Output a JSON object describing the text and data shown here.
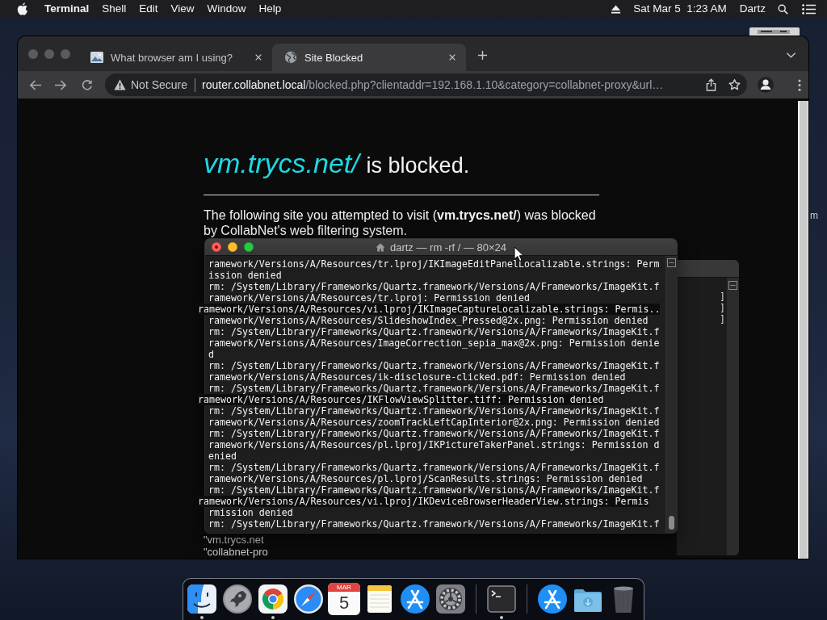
{
  "menu_bar": {
    "app": "Terminal",
    "menus": [
      "Shell",
      "Edit",
      "View",
      "Window",
      "Help"
    ],
    "clock": "Sat Mar 5  1:23 AM",
    "user": "Dartz"
  },
  "desktop": {
    "label": "m"
  },
  "browser": {
    "tabs": [
      {
        "title": "What browser am I using?",
        "selected": false
      },
      {
        "title": "Site Blocked",
        "selected": true
      }
    ],
    "address": {
      "security": "Not Secure",
      "host": "router.collabnet.local",
      "path": "/blocked.php?clientaddr=192.168.1.10&category=collabnet-proxy&url…"
    },
    "page": {
      "blocked_site": "vm.trycs.net/",
      "heading": "is blocked.",
      "message": "The following site you attempted to visit (**vm.trycs.net/**) was blocked by CollabNet's web filtering system.",
      "details": [
        "\"vm.trycs.net",
        "\"collabnet-pro"
      ]
    }
  },
  "background_window": {
    "lines": [
      "]",
      "]",
      "]"
    ]
  },
  "terminal": {
    "title": "dartz — rm -rf / — 80×24",
    "lines": [
      {
        "kind": "normal",
        "text": "ramework/Versions/A/Resources/tr.lproj/IKImageEditPanelLocalizable.strings: Perm"
      },
      {
        "kind": "normal",
        "text": "ission denied"
      },
      {
        "kind": "normal",
        "text": "rm: /System/Library/Frameworks/Quartz.framework/Versions/A/Frameworks/ImageKit.f"
      },
      {
        "kind": "normal",
        "text": "ramework/Versions/A/Resources/tr.lproj: Permission denied"
      },
      {
        "kind": "shifted",
        "text": "ramework/Versions/A/Resources/vi.lproj/IKImageCaptureLocalizable.strings: Permis.."
      },
      {
        "kind": "normal",
        "text": "ramework/Versions/A/Resources/SlideshowIndex_Pressed@2x.png: Permission denied"
      },
      {
        "kind": "normal",
        "text": "rm: /System/Library/Frameworks/Quartz.framework/Versions/A/Frameworks/ImageKit.f"
      },
      {
        "kind": "normal",
        "text": "ramework/Versions/A/Resources/ImageCorrection_sepia_max@2x.png: Permission denie"
      },
      {
        "kind": "normal",
        "text": "d"
      },
      {
        "kind": "normal",
        "text": "rm: /System/Library/Frameworks/Quartz.framework/Versions/A/Frameworks/ImageKit.f"
      },
      {
        "kind": "normal",
        "text": "ramework/Versions/A/Resources/ik-disclosure-clicked.pdf: Permission denied"
      },
      {
        "kind": "normal",
        "text": "rm: /System/Library/Frameworks/Quartz.framework/Versions/A/Frameworks/ImageKit.f"
      },
      {
        "kind": "shifted",
        "text": "ramework/Versions/A/Resources/IKFlowViewSplitter.tiff: Permission denied"
      },
      {
        "kind": "normal",
        "text": "rm: /System/Library/Frameworks/Quartz.framework/Versions/A/Frameworks/ImageKit.f"
      },
      {
        "kind": "normal",
        "text": "ramework/Versions/A/Resources/zoomTrackLeftCapInterior@2x.png: Permission denied"
      },
      {
        "kind": "normal",
        "text": "rm: /System/Library/Frameworks/Quartz.framework/Versions/A/Frameworks/ImageKit.f"
      },
      {
        "kind": "normal",
        "text": "ramework/Versions/A/Resources/pl.lproj/IKPictureTakerPanel.strings: Permission d"
      },
      {
        "kind": "normal",
        "text": "enied"
      },
      {
        "kind": "normal",
        "text": "rm: /System/Library/Frameworks/Quartz.framework/Versions/A/Frameworks/ImageKit.f"
      },
      {
        "kind": "normal",
        "text": "ramework/Versions/A/Resources/pl.lproj/ScanResults.strings: Permission denied"
      },
      {
        "kind": "normal",
        "text": "rm: /System/Library/Frameworks/Quartz.framework/Versions/A/Frameworks/ImageKit.f"
      },
      {
        "kind": "shifted",
        "text": "ramework/Versions/A/Resources/vi.lproj/IKDeviceBrowserHeaderView.strings: Permis"
      },
      {
        "kind": "normal",
        "text": "rmission denied"
      },
      {
        "kind": "normal",
        "text": "rm: /System/Library/Frameworks/Quartz.framework/Versions/A/Frameworks/ImageKit.f"
      }
    ]
  },
  "dock": [
    {
      "kind": "finder",
      "running": true
    },
    {
      "kind": "launchpad",
      "running": false
    },
    {
      "kind": "chrome",
      "running": true
    },
    {
      "kind": "safari",
      "running": false
    },
    {
      "kind": "calendar",
      "month": "MAR",
      "day": "5",
      "running": false
    },
    {
      "kind": "notes",
      "running": false
    },
    {
      "kind": "appstore",
      "running": false
    },
    {
      "kind": "preferences",
      "running": false
    },
    {
      "kind": "separator",
      "running": false
    },
    {
      "kind": "terminal",
      "running": true
    },
    {
      "kind": "separator",
      "running": false
    },
    {
      "kind": "appstore",
      "running": false
    },
    {
      "kind": "downloads",
      "running": false
    },
    {
      "kind": "trash",
      "running": false
    }
  ]
}
